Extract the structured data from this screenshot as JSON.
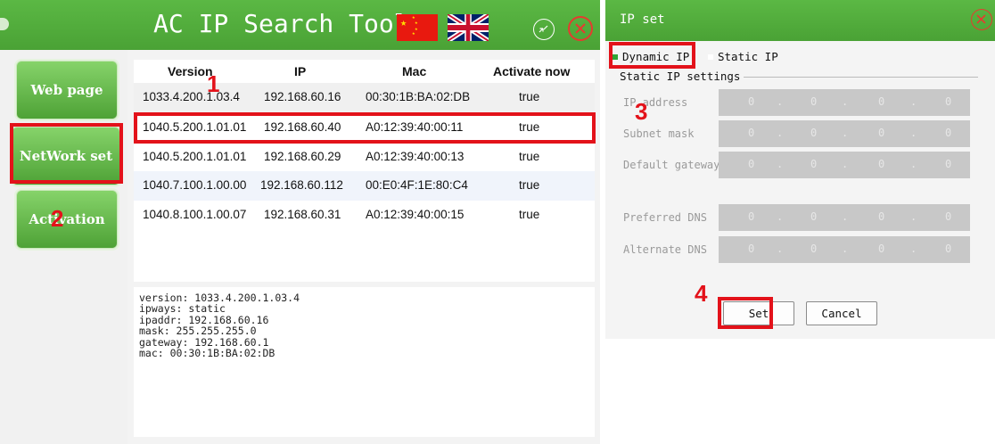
{
  "app": {
    "title": "AC IP Search Tool",
    "accent_color": "#4fae39",
    "highlight_color": "#e3121a"
  },
  "sidebar": {
    "items": [
      {
        "label": "Web page"
      },
      {
        "label": "NetWork set"
      },
      {
        "label": "Activation"
      }
    ]
  },
  "table": {
    "columns": [
      "Version",
      "IP",
      "Mac",
      "Activate now"
    ],
    "rows": [
      {
        "version": "1033.4.200.1.03.4",
        "ip": "192.168.60.16",
        "mac": "00:30:1B:BA:02:DB",
        "activate": "true"
      },
      {
        "version": "1040.5.200.1.01.01",
        "ip": "192.168.60.40",
        "mac": "A0:12:39:40:00:11",
        "activate": "true"
      },
      {
        "version": "1040.5.200.1.01.01",
        "ip": "192.168.60.29",
        "mac": "A0:12:39:40:00:13",
        "activate": "true"
      },
      {
        "version": "1040.7.100.1.00.00",
        "ip": "192.168.60.112",
        "mac": "00:E0:4F:1E:80:C4",
        "activate": "true"
      },
      {
        "version": "1040.8.100.1.00.07",
        "ip": "192.168.60.31",
        "mac": "A0:12:39:40:00:15",
        "activate": "true"
      }
    ]
  },
  "details": [
    "version: 1033.4.200.1.03.4",
    "ipways: static",
    "ipaddr: 192.168.60.16",
    "mask: 255.255.255.0",
    "gateway: 192.168.60.1",
    "mac: 00:30:1B:BA:02:DB"
  ],
  "dialog": {
    "title": "IP set",
    "mode_dynamic": "Dynamic IP",
    "mode_static": "Static IP",
    "selected_mode": "Dynamic IP",
    "static_settings_label": "Static IP settings",
    "fields": [
      {
        "label": "IP address",
        "octets": [
          "0",
          "0",
          "0",
          "0"
        ]
      },
      {
        "label": "Subnet mask",
        "octets": [
          "0",
          "0",
          "0",
          "0"
        ]
      },
      {
        "label": "Default gateway",
        "octets": [
          "0",
          "0",
          "0",
          "0"
        ]
      },
      {
        "label": "Preferred DNS",
        "octets": [
          "0",
          "0",
          "0",
          "0"
        ]
      },
      {
        "label": "Alternate DNS",
        "octets": [
          "0",
          "0",
          "0",
          "0"
        ]
      }
    ],
    "octet_separator": ".",
    "set_label": "Set",
    "cancel_label": "Cancel"
  },
  "callouts": [
    "1",
    "2",
    "3",
    "4"
  ]
}
